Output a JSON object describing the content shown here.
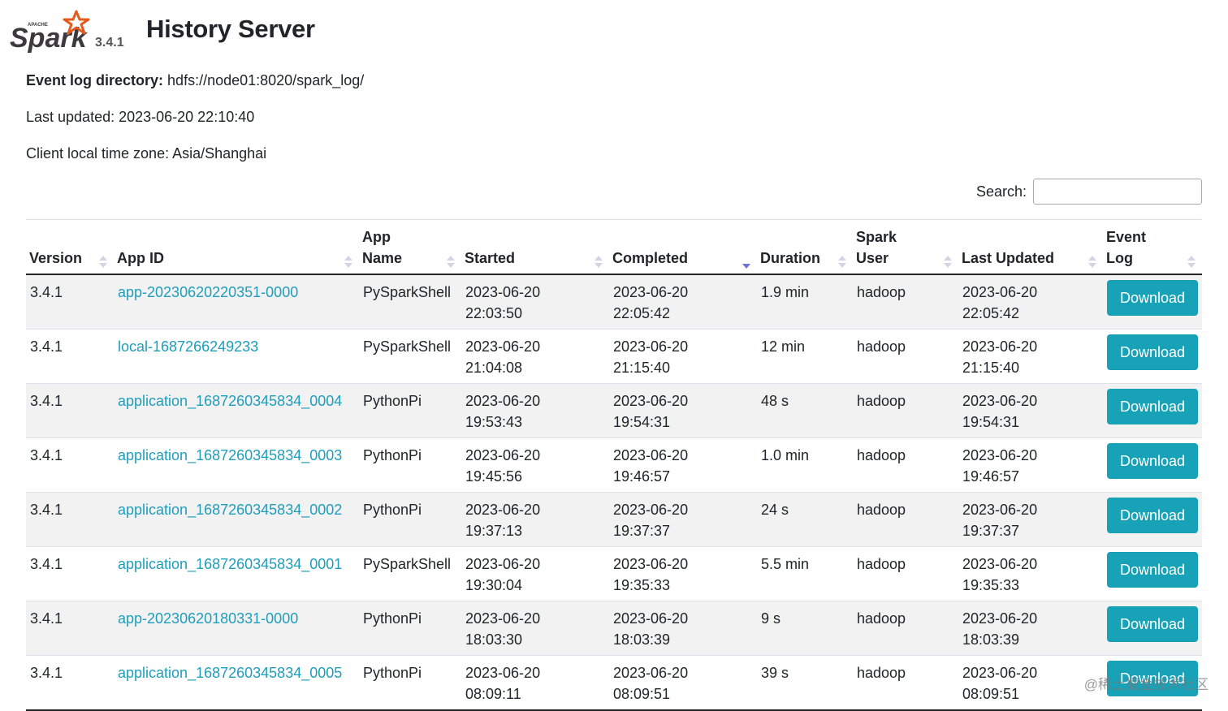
{
  "header": {
    "logo_text": "Spark",
    "logo_subtext": "APACHE",
    "version": "3.4.1",
    "title": "History Server"
  },
  "info": {
    "event_log_label": "Event log directory:",
    "event_log_value": "hdfs://node01:8020/spark_log/",
    "last_updated": "Last updated: 2023-06-20 22:10:40",
    "time_zone": "Client local time zone: Asia/Shanghai"
  },
  "search": {
    "label": "Search:",
    "value": ""
  },
  "table": {
    "columns": [
      {
        "l1": "",
        "l2": "Version"
      },
      {
        "l1": "",
        "l2": "App ID"
      },
      {
        "l1": "App",
        "l2": "Name"
      },
      {
        "l1": "",
        "l2": "Started"
      },
      {
        "l1": "",
        "l2": "Completed"
      },
      {
        "l1": "",
        "l2": "Duration"
      },
      {
        "l1": "Spark",
        "l2": "User"
      },
      {
        "l1": "",
        "l2": "Last Updated"
      },
      {
        "l1": "Event",
        "l2": "Log"
      }
    ],
    "sorted_column": "Completed",
    "rows": [
      {
        "version": "3.4.1",
        "app_id": "app-20230620220351-0000",
        "app_name": "PySparkShell",
        "started_date": "2023-06-20",
        "started_time": "22:03:50",
        "completed_date": "2023-06-20",
        "completed_time": "22:05:42",
        "duration": "1.9 min",
        "user": "hadoop",
        "updated_date": "2023-06-20",
        "updated_time": "22:05:42",
        "event_log": "Download"
      },
      {
        "version": "3.4.1",
        "app_id": "local-1687266249233",
        "app_name": "PySparkShell",
        "started_date": "2023-06-20",
        "started_time": "21:04:08",
        "completed_date": "2023-06-20",
        "completed_time": "21:15:40",
        "duration": "12 min",
        "user": "hadoop",
        "updated_date": "2023-06-20",
        "updated_time": "21:15:40",
        "event_log": "Download"
      },
      {
        "version": "3.4.1",
        "app_id": "application_1687260345834_0004",
        "app_name": "PythonPi",
        "started_date": "2023-06-20",
        "started_time": "19:53:43",
        "completed_date": "2023-06-20",
        "completed_time": "19:54:31",
        "duration": "48 s",
        "user": "hadoop",
        "updated_date": "2023-06-20",
        "updated_time": "19:54:31",
        "event_log": "Download"
      },
      {
        "version": "3.4.1",
        "app_id": "application_1687260345834_0003",
        "app_name": "PythonPi",
        "started_date": "2023-06-20",
        "started_time": "19:45:56",
        "completed_date": "2023-06-20",
        "completed_time": "19:46:57",
        "duration": "1.0 min",
        "user": "hadoop",
        "updated_date": "2023-06-20",
        "updated_time": "19:46:57",
        "event_log": "Download"
      },
      {
        "version": "3.4.1",
        "app_id": "application_1687260345834_0002",
        "app_name": "PythonPi",
        "started_date": "2023-06-20",
        "started_time": "19:37:13",
        "completed_date": "2023-06-20",
        "completed_time": "19:37:37",
        "duration": "24 s",
        "user": "hadoop",
        "updated_date": "2023-06-20",
        "updated_time": "19:37:37",
        "event_log": "Download"
      },
      {
        "version": "3.4.1",
        "app_id": "application_1687260345834_0001",
        "app_name": "PySparkShell",
        "started_date": "2023-06-20",
        "started_time": "19:30:04",
        "completed_date": "2023-06-20",
        "completed_time": "19:35:33",
        "duration": "5.5 min",
        "user": "hadoop",
        "updated_date": "2023-06-20",
        "updated_time": "19:35:33",
        "event_log": "Download"
      },
      {
        "version": "3.4.1",
        "app_id": "app-20230620180331-0000",
        "app_name": "PythonPi",
        "started_date": "2023-06-20",
        "started_time": "18:03:30",
        "completed_date": "2023-06-20",
        "completed_time": "18:03:39",
        "duration": "9 s",
        "user": "hadoop",
        "updated_date": "2023-06-20",
        "updated_time": "18:03:39",
        "event_log": "Download"
      },
      {
        "version": "3.4.1",
        "app_id": "application_1687260345834_0005",
        "app_name": "PythonPi",
        "started_date": "2023-06-20",
        "started_time": "08:09:11",
        "completed_date": "2023-06-20",
        "completed_time": "08:09:51",
        "duration": "39 s",
        "user": "hadoop",
        "updated_date": "2023-06-20",
        "updated_time": "08:09:51",
        "event_log": "Download"
      }
    ]
  },
  "watermark": "@稀土掘金技术社区",
  "colors": {
    "link": "#1d9ebb",
    "button": "#17a2b8",
    "stripe": "#f2f2f2",
    "sort_active": "#6b73d8"
  }
}
